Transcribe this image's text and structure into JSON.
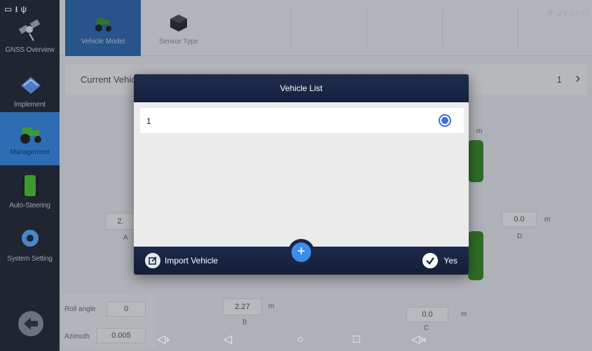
{
  "status_bar": {
    "left_icons": [
      "screenshot-icon",
      "download-icon",
      "usb-icon"
    ],
    "time": "12:42"
  },
  "sidebar": {
    "items": [
      {
        "label": "GNSS Overview",
        "icon": "satellite-icon",
        "active": false
      },
      {
        "label": "Implement",
        "icon": "implement-icon",
        "active": false
      },
      {
        "label": "Management",
        "icon": "tractor-icon",
        "active": true
      },
      {
        "label": "Auto-Steering",
        "icon": "steering-icon",
        "active": false
      },
      {
        "label": "System Setting",
        "icon": "gear-icon",
        "active": false
      }
    ],
    "back_icon": "back-arrow-icon"
  },
  "tabs": [
    {
      "label": "Vehicle Model",
      "icon": "tractor-icon",
      "active": true
    },
    {
      "label": "Sensor Type",
      "icon": "sensor-icon",
      "active": false
    }
  ],
  "current": {
    "label": "Current Vehicl",
    "value": "1"
  },
  "background": {
    "roll_label": "Roll angle",
    "roll_value": "0",
    "azimuth_label": "Azimuth",
    "azimuth_value": "0.005",
    "b_value": "2.27",
    "b_unit": "m",
    "b_label": "B",
    "c_value": "0.0",
    "c_unit": "m",
    "c_label": "C",
    "d_value": "0.0",
    "d_unit": "m",
    "d_label": "D",
    "a_value": "2.",
    "a_label": "A",
    "m_unit_top": "m"
  },
  "modal": {
    "title": "Vehicle List",
    "items": [
      {
        "label": "1",
        "selected": true
      }
    ],
    "import_label": "Import Vehicle",
    "yes_label": "Yes",
    "add_symbol": "+"
  },
  "navbar": {
    "buttons": [
      "volume-down-icon",
      "back-icon",
      "home-icon",
      "recents-icon",
      "volume-up-icon"
    ]
  },
  "colors": {
    "accent": "#2e6db4",
    "modal_header": "#1f2c4f",
    "radio": "#3a6ee0",
    "add_button": "#3b8ee8"
  }
}
